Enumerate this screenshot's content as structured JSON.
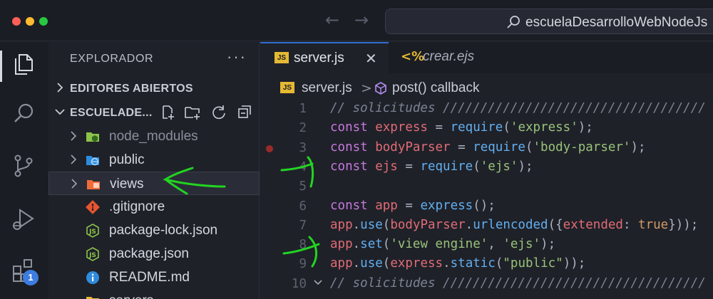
{
  "window": {
    "search_text": "escuelaDesarrolloWebNodeJs"
  },
  "activity_bar": {
    "items": [
      "explorer-icon",
      "search-icon",
      "source-control-icon",
      "run-debug-icon",
      "extensions-icon"
    ],
    "extensions_badge": "1"
  },
  "sidebar": {
    "title": "EXPLORADOR",
    "more": "···",
    "open_editors_label": "EDITORES ABIERTOS",
    "project_label": "ESCUELADE...",
    "files": [
      {
        "name": "node_modules",
        "type": "folder-node",
        "dim": true
      },
      {
        "name": "public",
        "type": "folder-public",
        "dim": false
      },
      {
        "name": "views",
        "type": "folder-views",
        "dim": false
      },
      {
        "name": ".gitignore",
        "type": "git",
        "dim": false
      },
      {
        "name": "package-lock.json",
        "type": "nodejs",
        "dim": false
      },
      {
        "name": "package.json",
        "type": "nodejs",
        "dim": false
      },
      {
        "name": "README.md",
        "type": "info",
        "dim": false
      },
      {
        "name": "servers",
        "type": "folder",
        "dim": false
      }
    ]
  },
  "tabs": [
    {
      "label": "server.js",
      "icon": "JS",
      "active": true
    },
    {
      "label": "crear.ejs",
      "icon": "<%",
      "active": false
    }
  ],
  "breadcrumb": {
    "file": "server.js",
    "separator": ">",
    "symbol": "post() callback"
  },
  "code": {
    "line_numbers": [
      "1",
      "2",
      "3",
      "4",
      "5",
      "6",
      "7",
      "8",
      "9",
      "10"
    ],
    "lines": [
      [
        {
          "t": "// solicitudes ///////////////////////////////////",
          "c": "com"
        }
      ],
      [
        {
          "t": "const ",
          "c": "kw"
        },
        {
          "t": "express",
          "c": "var"
        },
        {
          "t": " = ",
          "c": "pun"
        },
        {
          "t": "require",
          "c": "fn"
        },
        {
          "t": "(",
          "c": "pun"
        },
        {
          "t": "'express'",
          "c": "str"
        },
        {
          "t": ");",
          "c": "pun"
        }
      ],
      [
        {
          "t": "const ",
          "c": "kw"
        },
        {
          "t": "bodyParser",
          "c": "var"
        },
        {
          "t": " = ",
          "c": "pun"
        },
        {
          "t": "require",
          "c": "fn"
        },
        {
          "t": "(",
          "c": "pun"
        },
        {
          "t": "'body-parser'",
          "c": "str"
        },
        {
          "t": ");",
          "c": "pun"
        }
      ],
      [
        {
          "t": "const ",
          "c": "kw"
        },
        {
          "t": "ejs",
          "c": "var"
        },
        {
          "t": " = ",
          "c": "pun"
        },
        {
          "t": "require",
          "c": "fn"
        },
        {
          "t": "(",
          "c": "pun"
        },
        {
          "t": "'ejs'",
          "c": "str"
        },
        {
          "t": ");",
          "c": "pun"
        }
      ],
      [],
      [
        {
          "t": "const ",
          "c": "kw"
        },
        {
          "t": "app",
          "c": "var"
        },
        {
          "t": " = ",
          "c": "pun"
        },
        {
          "t": "express",
          "c": "fn"
        },
        {
          "t": "();",
          "c": "pun"
        }
      ],
      [
        {
          "t": "app",
          "c": "var"
        },
        {
          "t": ".",
          "c": "pun"
        },
        {
          "t": "use",
          "c": "fn"
        },
        {
          "t": "(",
          "c": "pun"
        },
        {
          "t": "bodyParser",
          "c": "var"
        },
        {
          "t": ".",
          "c": "pun"
        },
        {
          "t": "urlencoded",
          "c": "fn"
        },
        {
          "t": "({",
          "c": "pun"
        },
        {
          "t": "extended",
          "c": "prop"
        },
        {
          "t": ": ",
          "c": "pun"
        },
        {
          "t": "true",
          "c": "num"
        },
        {
          "t": "}));",
          "c": "pun"
        }
      ],
      [
        {
          "t": "app",
          "c": "var"
        },
        {
          "t": ".",
          "c": "pun"
        },
        {
          "t": "set",
          "c": "fn"
        },
        {
          "t": "(",
          "c": "pun"
        },
        {
          "t": "'view engine'",
          "c": "str"
        },
        {
          "t": ", ",
          "c": "pun"
        },
        {
          "t": "'ejs'",
          "c": "str"
        },
        {
          "t": ");",
          "c": "pun"
        }
      ],
      [
        {
          "t": "app",
          "c": "var"
        },
        {
          "t": ".",
          "c": "pun"
        },
        {
          "t": "use",
          "c": "fn"
        },
        {
          "t": "(",
          "c": "pun"
        },
        {
          "t": "express",
          "c": "var"
        },
        {
          "t": ".",
          "c": "pun"
        },
        {
          "t": "static",
          "c": "fn"
        },
        {
          "t": "(",
          "c": "pun"
        },
        {
          "t": "\"public\"",
          "c": "str"
        },
        {
          "t": "));",
          "c": "pun"
        }
      ],
      [
        {
          "t": "// solicitudes ///////////////////////////////////",
          "c": "com"
        }
      ]
    ]
  },
  "colors": {
    "accent": "#2f6fd1",
    "annotation": "#22d422",
    "js_badge": "#e5b933"
  }
}
